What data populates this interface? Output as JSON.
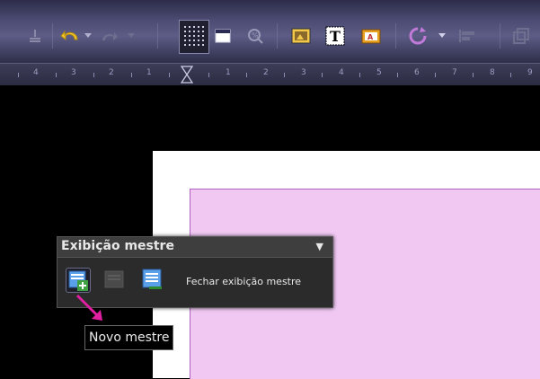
{
  "toolbar": {
    "buttons": [
      {
        "name": "anchor-icon"
      },
      {
        "name": "undo-icon"
      },
      {
        "name": "undo-dropdown-icon"
      },
      {
        "name": "redo-icon"
      },
      {
        "name": "redo-dropdown-icon"
      },
      {
        "name": "grid-icon"
      },
      {
        "name": "page-icon"
      },
      {
        "name": "zoom-icon"
      },
      {
        "name": "image-frame-icon"
      },
      {
        "name": "text-frame-icon"
      },
      {
        "name": "picture-icon"
      },
      {
        "name": "rotate-icon"
      },
      {
        "name": "rotate-dropdown-icon"
      },
      {
        "name": "align-icon"
      },
      {
        "name": "arrange-icon"
      }
    ],
    "accent": "#5c5c86"
  },
  "ruler": {
    "labels": [
      "4",
      "3",
      "2",
      "1",
      "1",
      "2",
      "3",
      "4",
      "5",
      "6",
      "7",
      "8",
      "9"
    ]
  },
  "canvas": {
    "page_color": "#ffffff",
    "master_color": "#f0c8f2"
  },
  "master_panel": {
    "title": "Exibição mestre",
    "new_master_icon": "new-master-icon",
    "rename_master_icon": "rename-master-icon",
    "close_master_icon": "close-master-icon",
    "close_label": "Fechar exibição mestre"
  },
  "tooltip": {
    "text": "Novo mestre"
  }
}
